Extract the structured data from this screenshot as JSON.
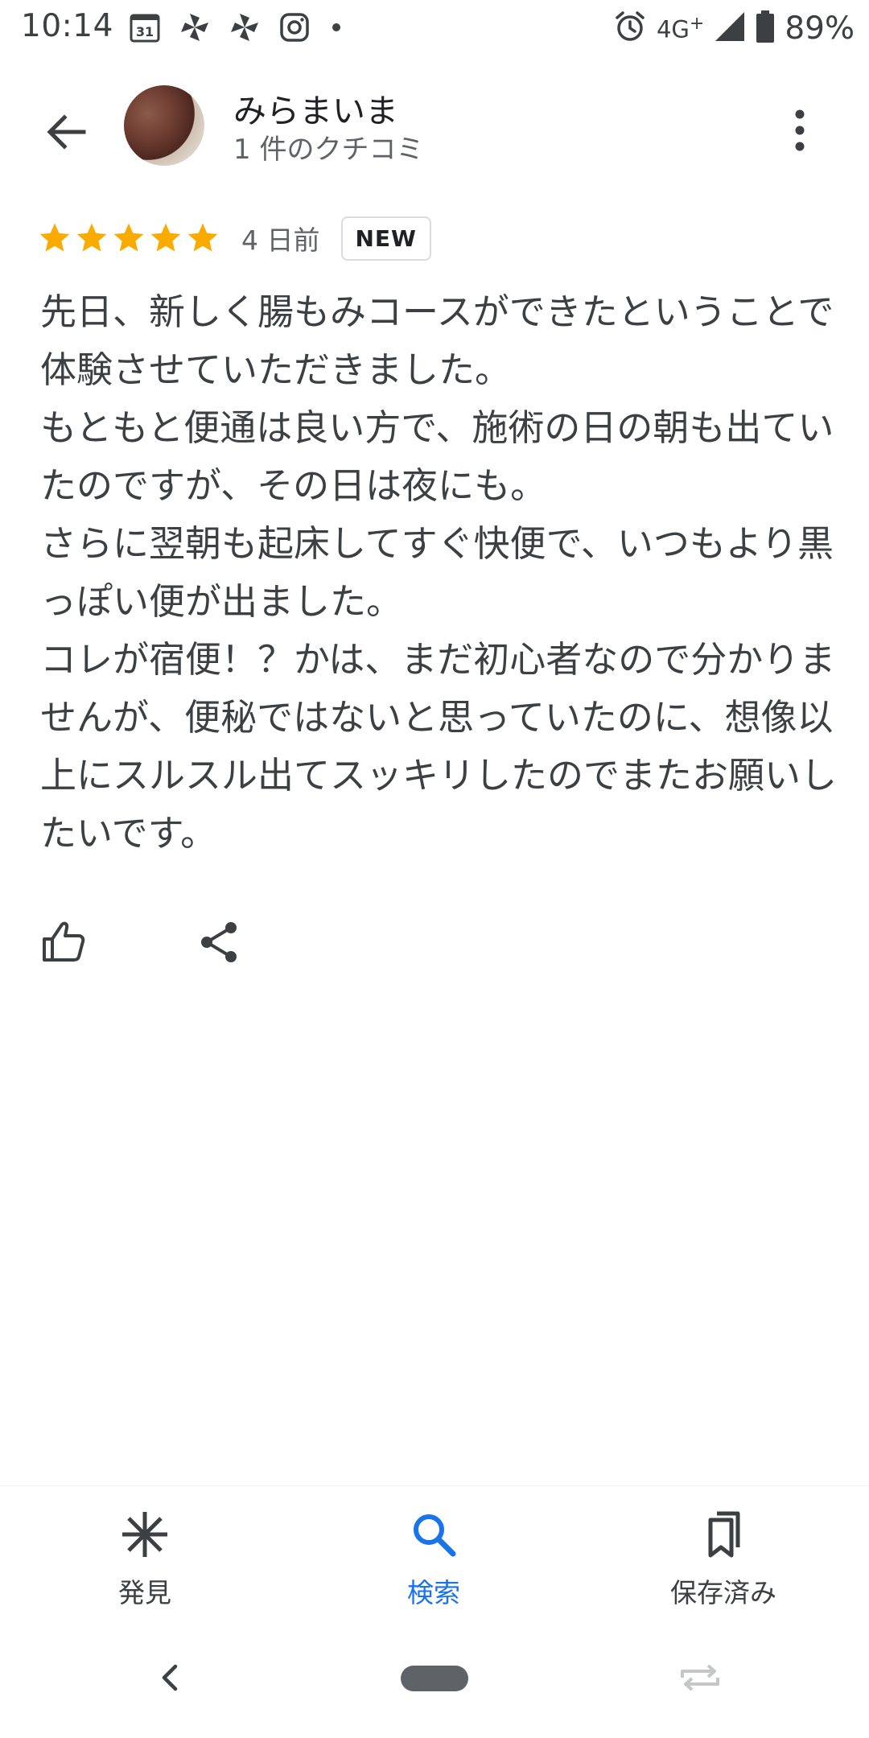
{
  "status_bar": {
    "time": "10:14",
    "calendar_day": "31",
    "network": "4G",
    "network_plus": "+",
    "battery": "89%",
    "icons": [
      "calendar-icon",
      "pinwheel-icon",
      "pinwheel-icon",
      "instagram-icon",
      "dot-icon",
      "alarm-icon",
      "signal-icon",
      "battery-icon"
    ]
  },
  "header": {
    "user_name": "みらまいま",
    "review_count": "1 件のクチコミ"
  },
  "review": {
    "rating": 5,
    "rating_max": 5,
    "star_color": "#f9ab00",
    "date": "4 日前",
    "badge": "NEW",
    "paragraphs": [
      "先日、新しく腸もみコースができたということで体験させていただきました。",
      "もともと便通は良い方で、施術の日の朝も出ていたのですが、その日は夜にも。",
      "さらに翌朝も起床してすぐ快便で、いつもより黒っぽい便が出ました。",
      "コレが宿便！？かは、まだ初心者なので分かりませんが、便秘ではないと思っていたのに、想像以上にスルスル出てスッキリしたのでまたお願いしたいです。"
    ]
  },
  "bottom_nav": {
    "items": [
      {
        "label": "発見",
        "icon": "asterisk-icon",
        "active": false
      },
      {
        "label": "検索",
        "icon": "search-icon",
        "active": true
      },
      {
        "label": "保存済み",
        "icon": "bookmarks-icon",
        "active": false
      }
    ],
    "active_color": "#1a73e8"
  }
}
